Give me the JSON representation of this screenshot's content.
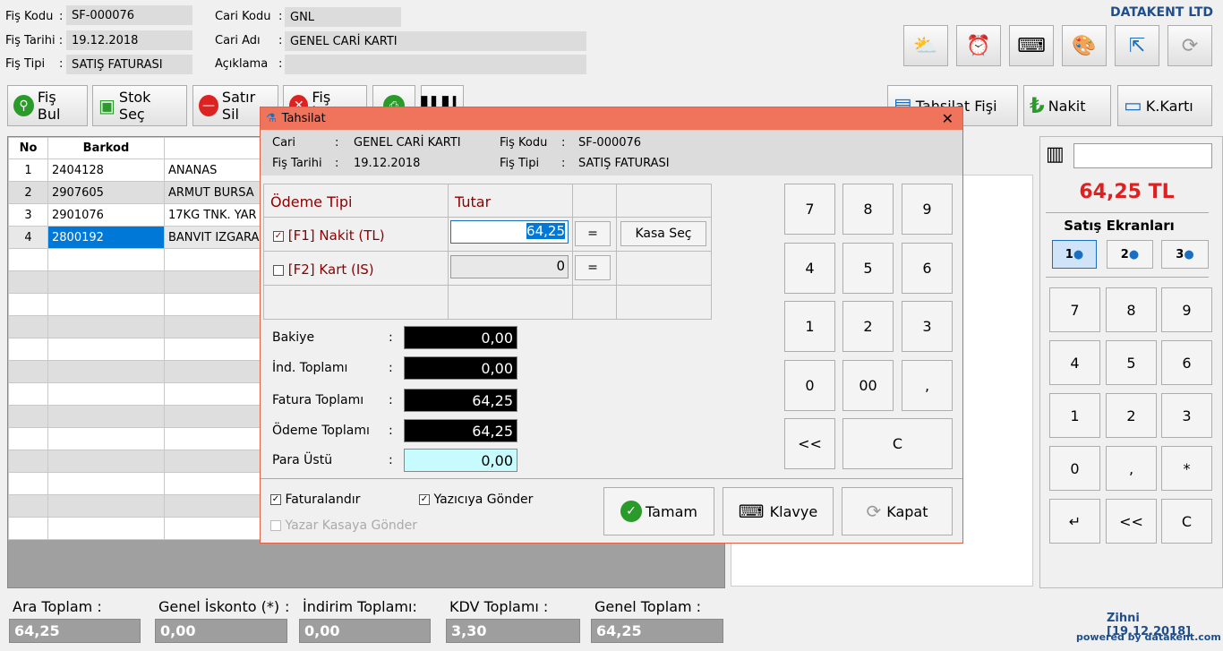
{
  "header": {
    "fis_kodu_label": "Fiş Kodu",
    "fis_kodu": "SF-000076",
    "fis_tarihi_label": "Fiş Tarihi :",
    "fis_tarihi": "19.12.2018",
    "fis_tipi_label": "Fiş Tipi",
    "fis_tipi": "SATIŞ FATURASI",
    "cari_kodu_label": "Cari Kodu",
    "cari_kodu": "GNL",
    "cari_adi_label": "Cari Adı",
    "cari_adi": "GENEL CARİ KARTI",
    "aciklama_label": "Açıklama",
    "aciklama": "",
    "company": "DATAKENT LTD"
  },
  "toolbar": {
    "fis_bul": "Fiş Bul",
    "stok_sec": "Stok Seç",
    "satir_sil": "Satır Sil",
    "fis_iptal": "Fiş İptal",
    "tahsilat_fisi": "Tahsilat Fişi",
    "nakit": "Nakit",
    "k_karti": "K.Kartı"
  },
  "grid": {
    "columns": [
      "No",
      "Barkod",
      ""
    ],
    "rows": [
      {
        "no": "1",
        "barkod": "2404128",
        "ad": "ANANAS"
      },
      {
        "no": "2",
        "barkod": "2907605",
        "ad": "ARMUT BURSA"
      },
      {
        "no": "3",
        "barkod": "2901076",
        "ad": "17KG TNK. YAR"
      },
      {
        "no": "4",
        "barkod": "2800192",
        "ad": "BANVIT IZGARA"
      }
    ]
  },
  "right_panel": {
    "total": "64,25 TL",
    "satis_ekranlari": "Satış Ekranları",
    "screens": [
      "1",
      "2",
      "3"
    ],
    "keypad": [
      "7",
      "8",
      "9",
      "4",
      "5",
      "6",
      "1",
      "2",
      "3",
      "0",
      ",",
      "*",
      "↵",
      "<<",
      "C"
    ]
  },
  "dialog": {
    "title": "Tahsilat",
    "cari_label": "Cari",
    "cari": "GENEL CARİ KARTI",
    "fis_kodu_label": "Fiş Kodu",
    "fis_kodu": "SF-000076",
    "fis_tarihi_label": "Fiş Tarihi",
    "fis_tarihi": "19.12.2018",
    "fis_tipi_label": "Fiş Tipi",
    "fis_tipi": "SATIŞ FATURASI",
    "odeme_tipi": "Ödeme Tipi",
    "tutar": "Tutar",
    "nakit_label": "[F1] Nakit (TL)",
    "nakit_value": "64,25",
    "kart_label": "[F2] Kart (IS)",
    "kart_value": "0",
    "eq": "=",
    "kasa_sec": "Kasa Seç",
    "bakiye_label": "Bakiye",
    "bakiye": "0,00",
    "ind_label": "İnd. Toplamı",
    "ind": "0,00",
    "fatura_label": "Fatura Toplamı",
    "fatura": "64,25",
    "odeme_label": "Ödeme Toplamı",
    "odeme": "64,25",
    "para_label": "Para Üstü",
    "para": "0,00",
    "colon": ":",
    "keypad": [
      "7",
      "8",
      "9",
      "4",
      "5",
      "6",
      "1",
      "2",
      "3",
      "0",
      "00",
      ",",
      "<<",
      "C"
    ],
    "faturalandir": "Faturalandır",
    "yaziciya": "Yazıcıya Gönder",
    "yazar_kasa": "Yazar Kasaya Gönder",
    "tamam": "Tamam",
    "klavye": "Klavye",
    "kapat": "Kapat"
  },
  "footer": {
    "ara_label": "Ara Toplam :",
    "ara": "64,25",
    "iskonto_label": "Genel İskonto (*)",
    "iskonto": "0,00",
    "indirim_label": "İndirim  Toplamı:",
    "indirim": "0,00",
    "kdv_label": "KDV Toplamı :",
    "kdv": "3,30",
    "genel_label": "Genel Toplam :",
    "genel": "64,25",
    "user": "Zihni [19.12.2018]",
    "powered": "powered by datakent.com"
  },
  "colors": {
    "accent": "#e02020",
    "title_bar": "#f0735c",
    "selection": "#0078d7",
    "brand": "#1f4e8c"
  }
}
